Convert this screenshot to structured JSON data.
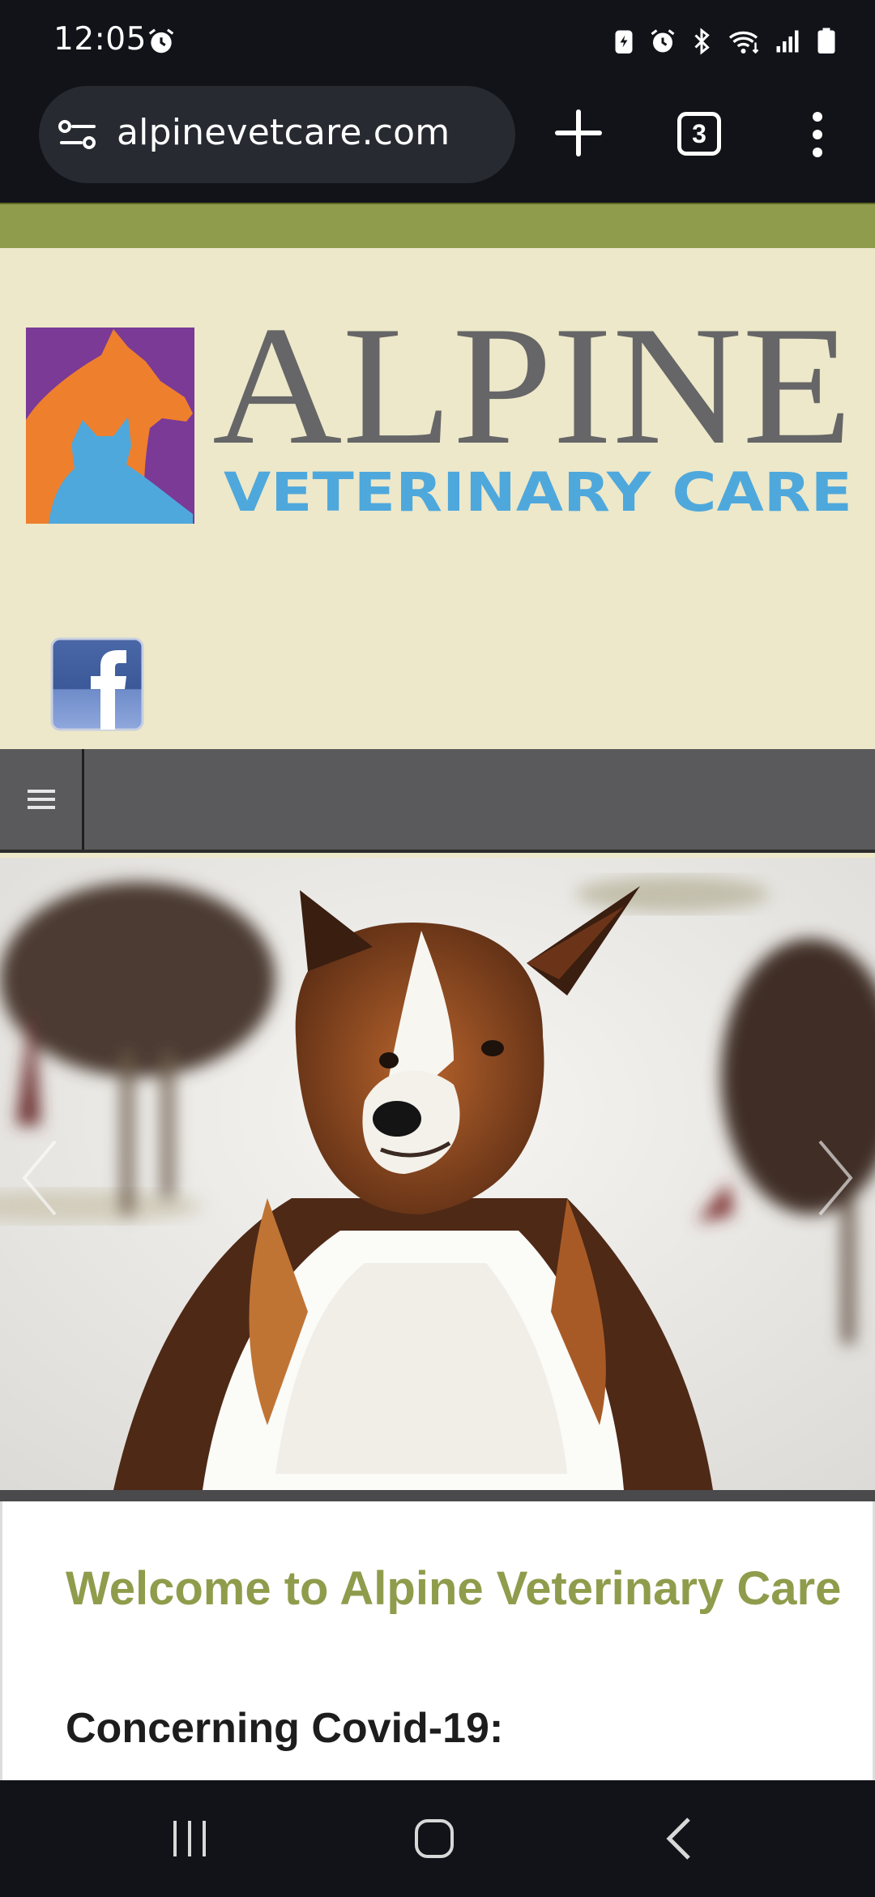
{
  "status_bar": {
    "time": "12:05",
    "icons": [
      "alarm-icon",
      "battery-saver-icon",
      "alarm-icon",
      "bluetooth-icon",
      "wifi-icon",
      "signal-icon",
      "battery-icon"
    ]
  },
  "browser": {
    "url": "alpinevetcare.com",
    "tab_count": "3",
    "icons": [
      "site-settings-icon",
      "new-tab-icon",
      "tab-switcher-icon",
      "more-menu-icon"
    ]
  },
  "site": {
    "logo_title": "ALPINE",
    "logo_subtitle": "VETERINARY CARE",
    "social": [
      "facebook"
    ],
    "welcome_heading": "Welcome to Alpine Veterinary Care",
    "covid_heading": "Concerning Covid-19:"
  },
  "colors": {
    "accent_olive": "#8f9c4c",
    "header_bg": "#ede8c9",
    "nav_gray": "#5a5a5c",
    "logo_purple": "#7a3a96",
    "logo_orange": "#ee7f2d",
    "logo_blue": "#4ea8dc",
    "logo_gray": "#666668"
  },
  "system_nav": [
    "recents-icon",
    "home-icon",
    "back-icon"
  ]
}
